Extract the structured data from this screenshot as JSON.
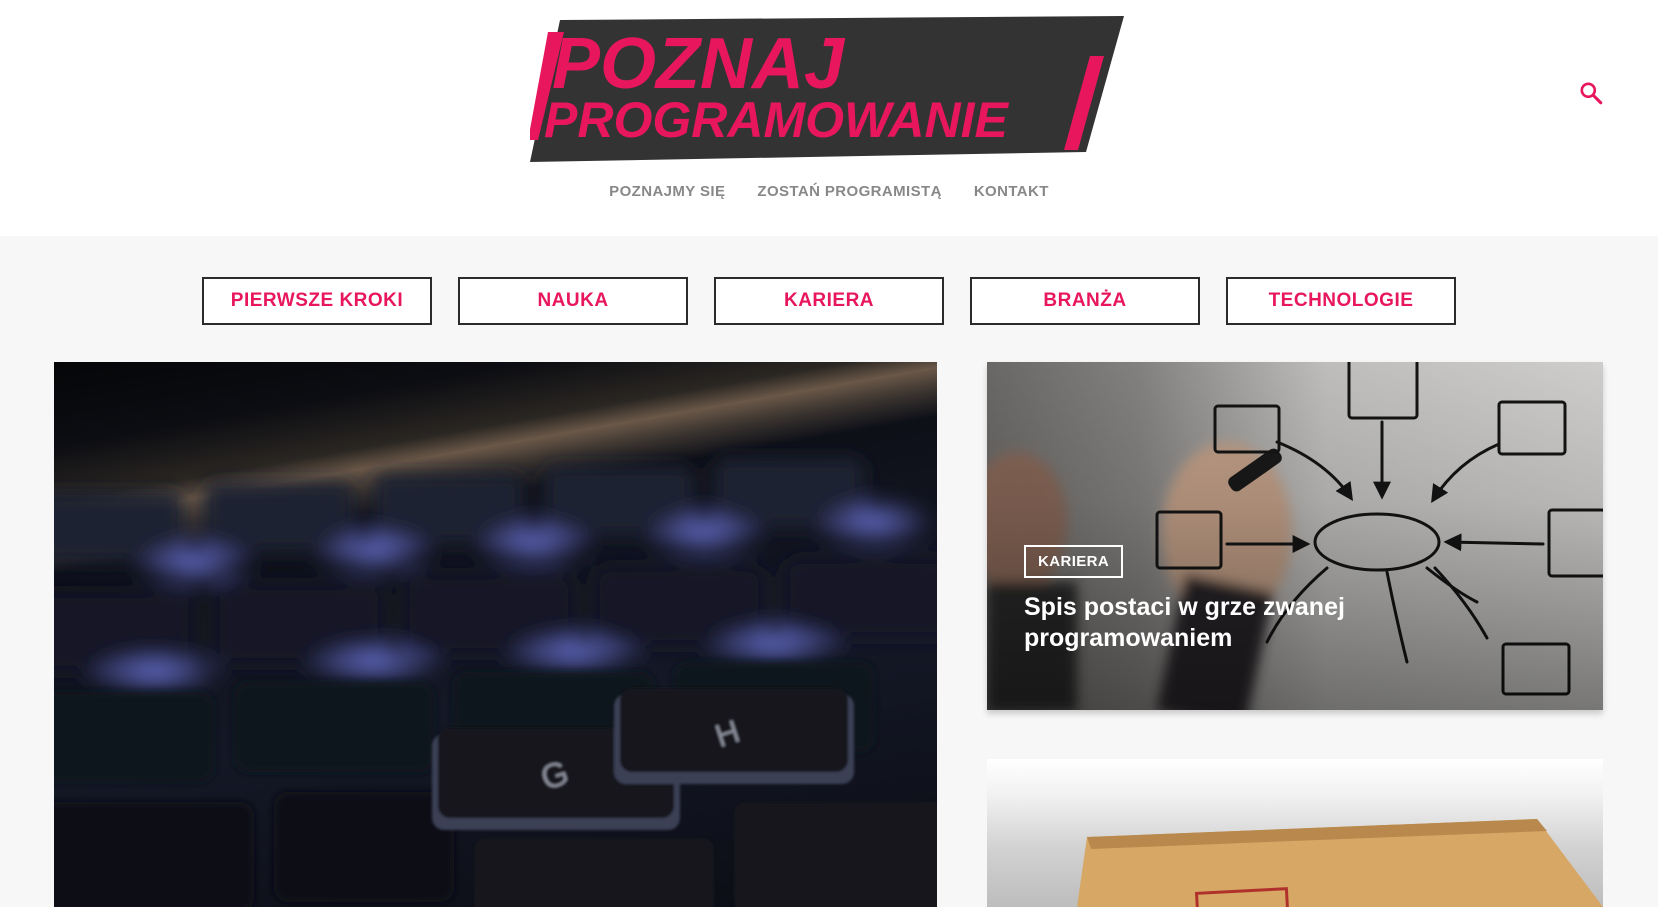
{
  "brand": {
    "logo_line1": "POZNAJ",
    "logo_line2": "PROGRAMOWANIE",
    "accent_color": "#e8175d",
    "dark_color": "#333333"
  },
  "header": {
    "search_icon": "search-icon",
    "nav": [
      {
        "label": "POZNAJMY SIĘ"
      },
      {
        "label": "ZOSTAŃ PROGRAMISTĄ"
      },
      {
        "label": "KONTAKT"
      }
    ]
  },
  "categories": [
    {
      "label": "PIERWSZE KROKI"
    },
    {
      "label": "NAUKA"
    },
    {
      "label": "KARIERA"
    },
    {
      "label": "BRANŻA"
    },
    {
      "label": "TECHNOLOGIE"
    }
  ],
  "posts": {
    "featured": {
      "image": "blurred laptop keyboard photo"
    },
    "side": [
      {
        "tag": "KARIERA",
        "title": "Spis postaci w grze zwanej programowaniem",
        "image": "hand drawing mind-map diagram"
      },
      {
        "image": "envelope with stamp"
      }
    ]
  }
}
